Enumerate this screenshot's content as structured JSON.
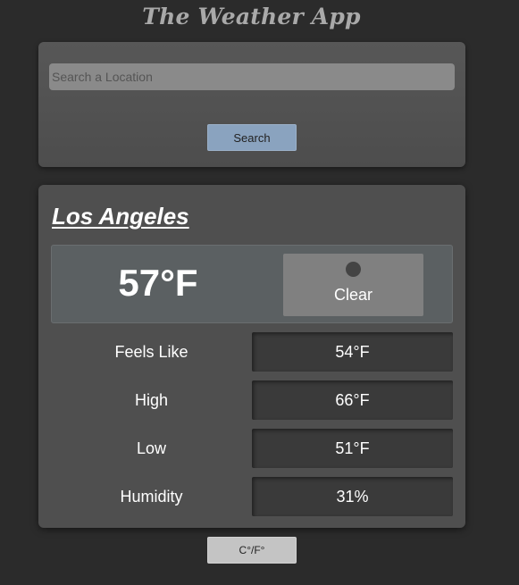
{
  "app": {
    "title": "The Weather App"
  },
  "search": {
    "placeholder": "Search a Location",
    "value": "",
    "button_label": "Search"
  },
  "weather": {
    "city": "Los Angeles",
    "temperature": "57°F",
    "condition": "Clear",
    "condition_icon": "circle-icon",
    "stats": [
      {
        "label": "Feels Like",
        "value": "54°F"
      },
      {
        "label": "High",
        "value": "66°F"
      },
      {
        "label": "Low",
        "value": "51°F"
      },
      {
        "label": "Humidity",
        "value": "31%"
      }
    ]
  },
  "units": {
    "toggle_label": "C°/F°"
  },
  "colors": {
    "background": "#2b2b2b",
    "card": "#4f4f4f",
    "search_button": "#8aa3bf",
    "stat_value_bg": "#3a3a3a"
  }
}
